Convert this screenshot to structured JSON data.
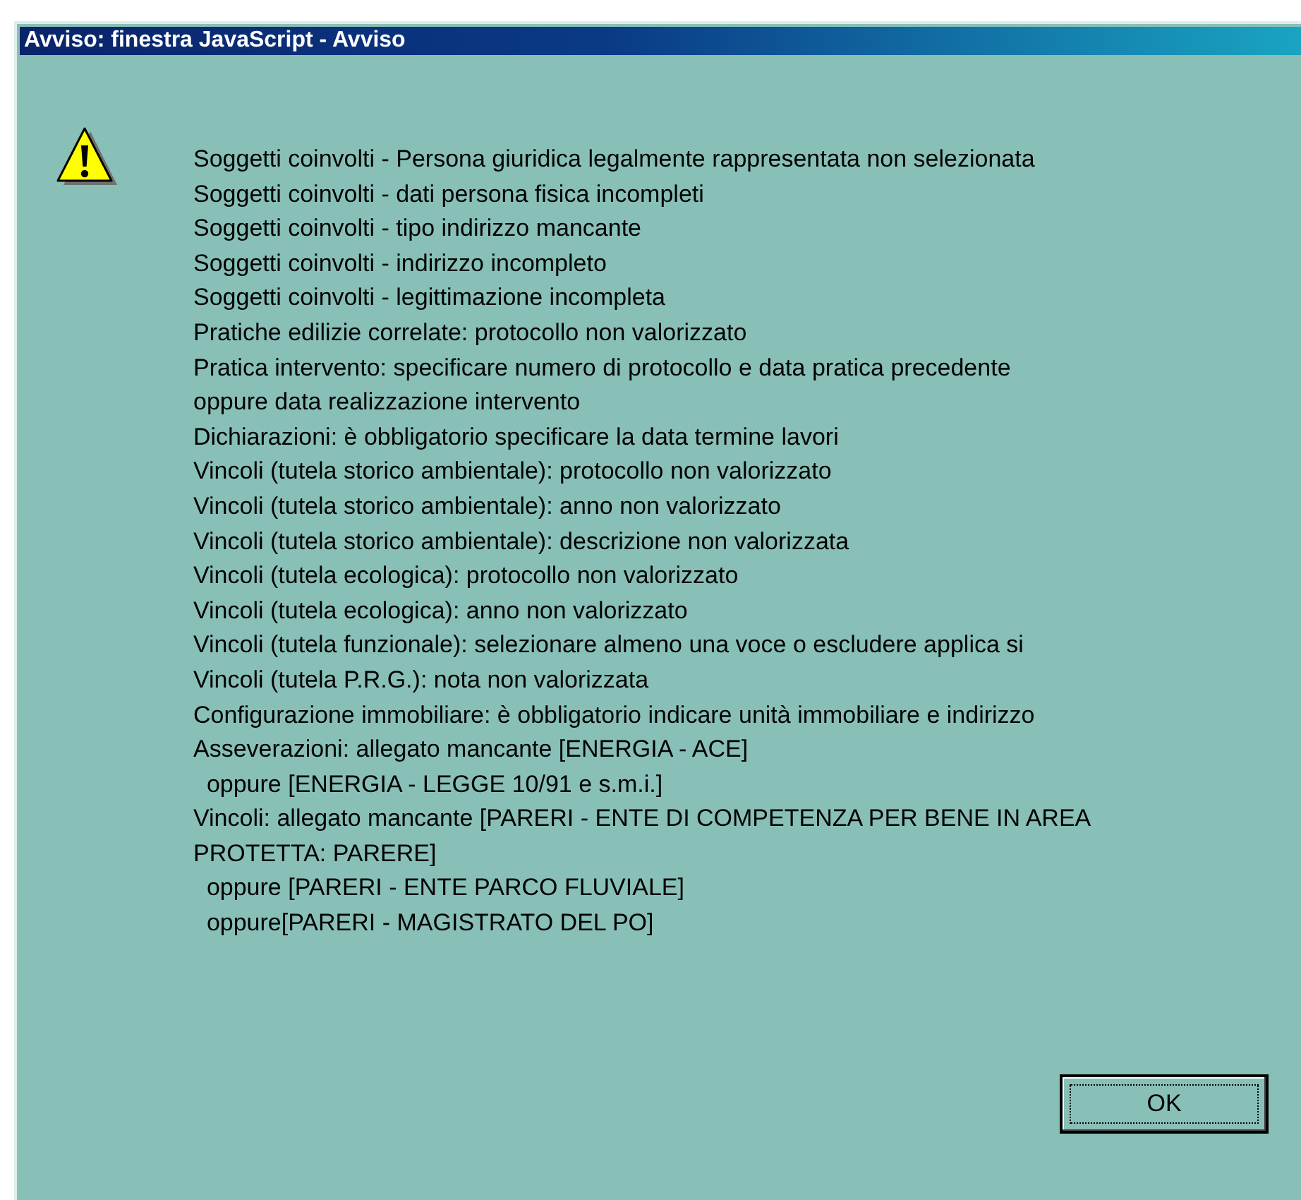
{
  "window": {
    "title": "Avviso: finestra JavaScript - Avviso"
  },
  "messages": [
    "Soggetti coinvolti - Persona giuridica legalmente rappresentata non selezionata",
    "Soggetti coinvolti - dati persona fisica incompleti",
    "Soggetti coinvolti - tipo indirizzo mancante",
    "Soggetti coinvolti - indirizzo incompleto",
    "Soggetti coinvolti - legittimazione incompleta",
    "Pratiche edilizie correlate: protocollo non valorizzato",
    "Pratica intervento: specificare numero di protocollo e data pratica precedente",
    "oppure data realizzazione intervento",
    "Dichiarazioni: è obbligatorio specificare la data termine lavori",
    "Vincoli (tutela storico ambientale): protocollo non valorizzato",
    "Vincoli (tutela storico ambientale): anno non valorizzato",
    "Vincoli (tutela storico ambientale): descrizione non valorizzata",
    "Vincoli (tutela ecologica): protocollo non valorizzato",
    "Vincoli (tutela ecologica): anno non valorizzato",
    "Vincoli (tutela funzionale): selezionare almeno una voce o escludere applica si",
    "Vincoli (tutela P.R.G.): nota non valorizzata",
    "Configurazione immobiliare: è obbligatorio indicare unità immobiliare e indirizzo",
    "Asseverazioni: allegato mancante [ENERGIA - ACE]",
    "  oppure [ENERGIA - LEGGE 10/91 e s.m.i.]",
    "Vincoli: allegato mancante [PARERI - ENTE DI COMPETENZA PER BENE IN AREA",
    "PROTETTA: PARERE]",
    "  oppure [PARERI - ENTE PARCO FLUVIALE]",
    "  oppure[PARERI - MAGISTRATO DEL PO]"
  ],
  "buttons": [
    {
      "label": "OK",
      "focused": true
    }
  ]
}
